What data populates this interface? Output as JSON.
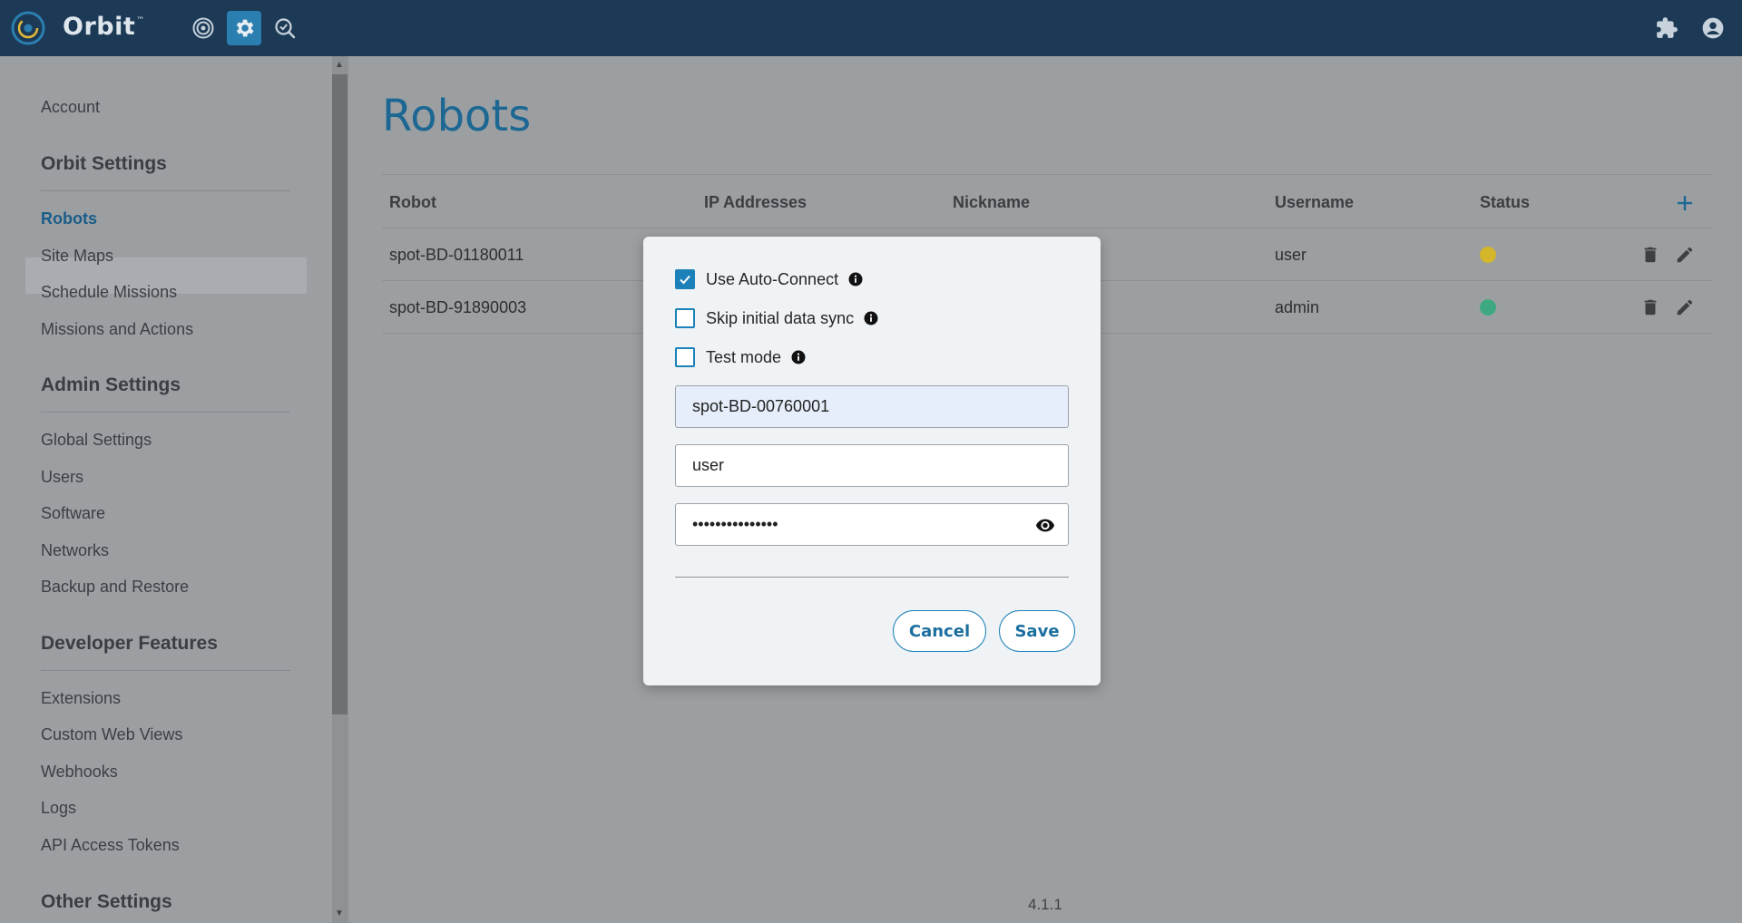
{
  "app": {
    "name": "Orbit",
    "trademark": "™"
  },
  "topbar": {
    "nav_icons": [
      "dashboard-icon",
      "settings-icon",
      "search-check-icon"
    ],
    "active": "settings-icon",
    "right_icons": [
      "extensions-icon",
      "account-icon"
    ],
    "bg_color": "#1c3a56",
    "accent_color": "#2b7fb0"
  },
  "sidebar": {
    "account": "Account",
    "sections": [
      {
        "title": "Orbit Settings",
        "items": [
          "Robots",
          "Site Maps",
          "Schedule Missions",
          "Missions and Actions"
        ]
      },
      {
        "title": "Admin Settings",
        "items": [
          "Global Settings",
          "Users",
          "Software",
          "Networks",
          "Backup and Restore"
        ]
      },
      {
        "title": "Developer Features",
        "items": [
          "Extensions",
          "Custom Web Views",
          "Webhooks",
          "Logs",
          "API Access Tokens"
        ]
      },
      {
        "title": "Other Settings",
        "items": []
      }
    ],
    "active_item": "Robots"
  },
  "main": {
    "title": "Robots",
    "columns": [
      "Robot",
      "IP Addresses",
      "Nickname",
      "Username",
      "Status"
    ],
    "rows": [
      {
        "robot": "spot-BD-01180011",
        "username": "user",
        "status_color": "#d4b62a"
      },
      {
        "robot": "spot-BD-91890003",
        "username": "admin",
        "status_color": "#3ea981"
      }
    ],
    "version": "4.1.1"
  },
  "modal": {
    "options": [
      {
        "label": "Use Auto-Connect",
        "checked": true
      },
      {
        "label": "Skip initial data sync",
        "checked": false
      },
      {
        "label": "Test mode",
        "checked": false
      }
    ],
    "hostname_value": "spot-BD-00760001",
    "username_value": "user",
    "password_masked": "•••••••••••••••",
    "cancel_label": "Cancel",
    "save_label": "Save"
  }
}
